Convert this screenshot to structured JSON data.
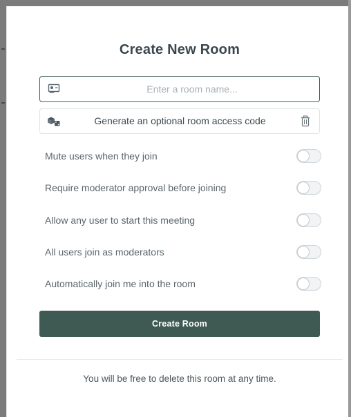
{
  "modal": {
    "title": "Create New Room",
    "name_input": {
      "value": "",
      "placeholder": "Enter a room name...",
      "icon": "room-name-icon"
    },
    "access_code": {
      "label": "Generate an optional room access code",
      "left_icon": "dice-icon",
      "right_icon": "trash-icon"
    },
    "options": [
      {
        "label": "Mute users when they join",
        "enabled": false
      },
      {
        "label": "Require moderator approval before joining",
        "enabled": false
      },
      {
        "label": "Allow any user to start this meeting",
        "enabled": false
      },
      {
        "label": "All users join as moderators",
        "enabled": false
      },
      {
        "label": "Automatically join me into the room",
        "enabled": false
      }
    ],
    "create_button_label": "Create Room",
    "footer_note": "You will be free to delete this room at any time."
  },
  "colors": {
    "primary": "#3f5a52",
    "input_border": "#3f5d55",
    "text": "#3d4a52",
    "toggle_off_bg": "#f1f3f4"
  }
}
